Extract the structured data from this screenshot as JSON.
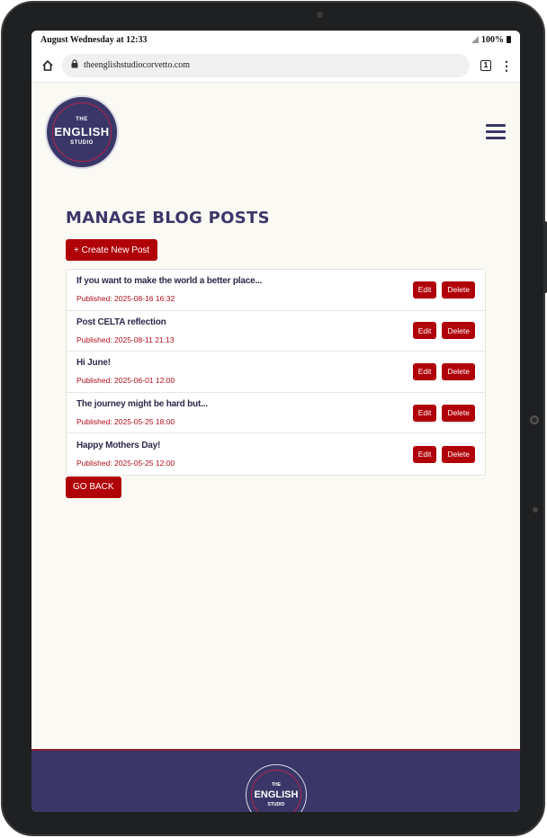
{
  "statusbar": {
    "time_text": "August Wednesday at 12:33",
    "battery_text": "100%"
  },
  "browser": {
    "url": "theenglishstudiocorvetto.com",
    "tab_count": "1"
  },
  "logo": {
    "line1": "THE",
    "line2": "ENGLISH",
    "line3": "STUDIO"
  },
  "main": {
    "title": "MANAGE BLOG POSTS",
    "create_label": "+ Create New Post",
    "back_label": "GO BACK",
    "edit_label": "Edit",
    "delete_label": "Delete",
    "posts": [
      {
        "title": "If you want to make the world a better place...",
        "published": "Published: 2025-08-16 16:32"
      },
      {
        "title": "Post CELTA reflection",
        "published": "Published: 2025-08-11 21:13"
      },
      {
        "title": "Hi June!",
        "published": "Published: 2025-06-01 12:00"
      },
      {
        "title": "The journey might be hard but...",
        "published": "Published: 2025-05-25 18:00"
      },
      {
        "title": "Happy Mothers Day!",
        "published": "Published: 2025-05-25 12:00"
      }
    ]
  },
  "colors": {
    "brand_navy": "#3a3768",
    "accent_red": "#b00008",
    "background": "#fbf9f4"
  }
}
